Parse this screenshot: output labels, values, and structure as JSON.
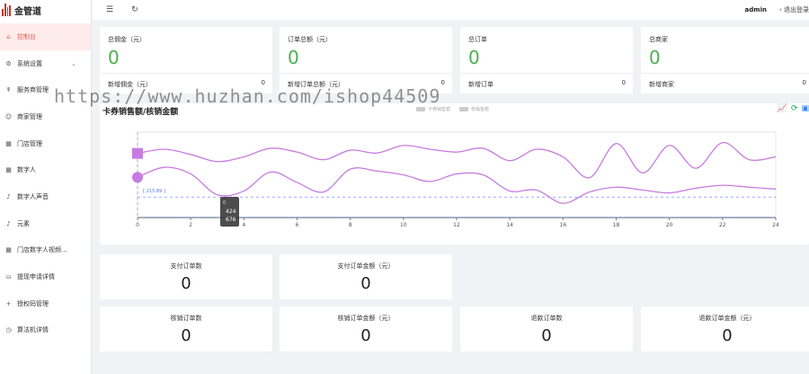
{
  "app": {
    "logo_text": "金管道"
  },
  "topbar": {
    "user": "admin",
    "logout": "退出登录"
  },
  "sidebar": {
    "items": [
      {
        "label": "控制台",
        "icon": "home-icon",
        "glyph": "⌂",
        "active": true
      },
      {
        "label": "系统设置",
        "icon": "settings-icon",
        "glyph": "⚙",
        "chevron": true
      },
      {
        "label": "服务商管理",
        "icon": "service-icon",
        "glyph": "☤"
      },
      {
        "label": "商家管理",
        "icon": "merchant-icon",
        "glyph": "☺"
      },
      {
        "label": "门店管理",
        "icon": "store-icon",
        "glyph": "▦"
      },
      {
        "label": "数字人",
        "icon": "digital-human-icon",
        "glyph": "▦"
      },
      {
        "label": "数字人声音",
        "icon": "voice-icon",
        "glyph": "♪"
      },
      {
        "label": "元素",
        "icon": "element-icon",
        "glyph": "♪"
      },
      {
        "label": "门店数字人视频...",
        "icon": "video-icon",
        "glyph": "▦"
      },
      {
        "label": "提现申请详情",
        "icon": "withdraw-icon",
        "glyph": "⛀"
      },
      {
        "label": "授权码管理",
        "icon": "auth-code-icon",
        "glyph": "+"
      },
      {
        "label": "算法机详情",
        "icon": "algorithm-icon",
        "glyph": "◷"
      }
    ]
  },
  "stats": [
    {
      "title": "总佣金（元）",
      "value": "0",
      "sub_label": "新增佣金（元）",
      "sub_value": "0"
    },
    {
      "title": "订单总额（元）",
      "value": "0",
      "sub_label": "新增订单总额（元）",
      "sub_value": "0"
    },
    {
      "title": "总订单",
      "value": "0",
      "sub_label": "新增订单",
      "sub_value": "0"
    },
    {
      "title": "总商家",
      "value": "0",
      "sub_label": "新增商家",
      "sub_value": "0"
    }
  ],
  "chart": {
    "title": "卡券销售额/核销金额",
    "legend": [
      "卡券销售额",
      "核销金额"
    ],
    "markline_label": "{ 215.89 }",
    "tooltip": {
      "label": "0",
      "values": [
        "424",
        "676"
      ]
    },
    "colors": {
      "line": "#c77be0",
      "axis": "#6e7f99",
      "markline": "#9aa9ff"
    }
  },
  "chart_data": {
    "type": "line",
    "title": "卡券销售额/核销金额",
    "x_ticks": [
      "0",
      "2",
      "4",
      "6",
      "8",
      "10",
      "12",
      "14",
      "16",
      "18",
      "20",
      "22",
      "24"
    ],
    "xlim": [
      0,
      24
    ],
    "series": [
      {
        "name": "卡券销售额",
        "x": [
          0,
          1,
          2,
          3,
          4,
          5,
          6,
          7,
          8,
          9,
          10,
          11,
          12,
          13,
          14,
          15,
          16,
          17,
          18,
          19,
          20,
          21,
          22,
          23,
          24
        ],
        "values": [
          676,
          720,
          665,
          590,
          640,
          730,
          690,
          610,
          710,
          680,
          760,
          720,
          690,
          730,
          600,
          720,
          640,
          420,
          780,
          470,
          760,
          520,
          790,
          610,
          640
        ]
      },
      {
        "name": "核销金额",
        "x": [
          0,
          1,
          2,
          3,
          4,
          5,
          6,
          7,
          8,
          9,
          10,
          11,
          12,
          13,
          14,
          15,
          16,
          17,
          18,
          19,
          20,
          21,
          22,
          23,
          24
        ],
        "values": [
          424,
          530,
          460,
          240,
          280,
          480,
          370,
          270,
          510,
          490,
          450,
          380,
          460,
          450,
          280,
          290,
          150,
          270,
          320,
          290,
          260,
          310,
          340,
          320,
          300
        ]
      }
    ],
    "y_range": [
      0,
      900
    ],
    "markline_value": 215.89
  },
  "orders_row1": [
    {
      "title": "支付订单数",
      "value": "0"
    },
    {
      "title": "支付订单金额（元）",
      "value": "0"
    }
  ],
  "orders_row2": [
    {
      "title": "核销订单数",
      "value": "0"
    },
    {
      "title": "核销订单金额（元）",
      "value": "0"
    },
    {
      "title": "退款订单数",
      "value": "0"
    },
    {
      "title": "退款订单金额（元）",
      "value": "0"
    }
  ],
  "watermark": "https://www.huzhan.com/ishop44509"
}
